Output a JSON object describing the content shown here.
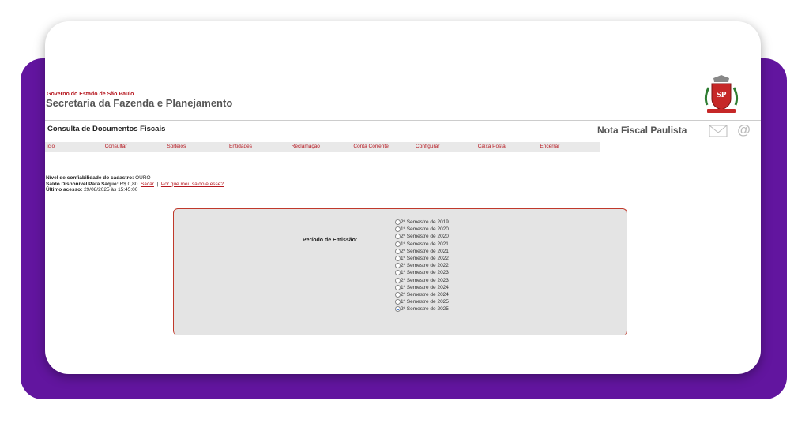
{
  "header": {
    "gov_line": "Governo do Estado de São Paulo",
    "secretaria": "Secretaria da Fazenda e Planejamento",
    "crest_text": "SP"
  },
  "subheader": {
    "page_title": "Consulta de Documentos Fiscais",
    "brand": "Nota Fiscal Paulista"
  },
  "menu": [
    {
      "label": "ício"
    },
    {
      "label": "Consultar"
    },
    {
      "label": "Sorteios"
    },
    {
      "label": "Entidades"
    },
    {
      "label": "Reclamação"
    },
    {
      "label": "Conta Corrente"
    },
    {
      "label": "Configurar"
    },
    {
      "label": "Caixa Postal"
    },
    {
      "label": "Encerrar"
    }
  ],
  "info": {
    "nivel_label": "Nível de confiabilidade do cadastro:",
    "nivel_value": "OURO",
    "saldo_label": "Saldo Disponível Para Saque:",
    "saldo_value": "R$ 0,80",
    "sacar_link": "Sacar",
    "separator": "|",
    "porque_link": "Por que meu saldo é esse?",
    "ultimo_label": "Último acesso:",
    "ultimo_value": "29/08/2025 às 15:45:00"
  },
  "form": {
    "periodo_label": "Período de Emissão:",
    "options": [
      {
        "label": "2º Semestre de 2019",
        "checked": false
      },
      {
        "label": "1º Semestre de 2020",
        "checked": false
      },
      {
        "label": "2º Semestre de 2020",
        "checked": false
      },
      {
        "label": "1º Semestre de 2021",
        "checked": false
      },
      {
        "label": "2º Semestre de 2021",
        "checked": false
      },
      {
        "label": "1º Semestre de 2022",
        "checked": false
      },
      {
        "label": "2º Semestre de 2022",
        "checked": false
      },
      {
        "label": "1º Semestre de 2023",
        "checked": false
      },
      {
        "label": "2º Semestre de 2023",
        "checked": false
      },
      {
        "label": "1º Semestre de 2024",
        "checked": false
      },
      {
        "label": "2º Semestre de 2024",
        "checked": false
      },
      {
        "label": "1º Semestre de 2025",
        "checked": false
      },
      {
        "label": "2º Semestre de 2025",
        "checked": true
      }
    ]
  },
  "colors": {
    "brand_red": "#b5161e",
    "frame_purple": "#62159f",
    "menu_bg": "#e9e9e9",
    "panel_bg": "#e4e4e4"
  },
  "icons": {
    "mail": "mail-icon",
    "at": "at-icon",
    "crest": "state-crest-icon"
  }
}
